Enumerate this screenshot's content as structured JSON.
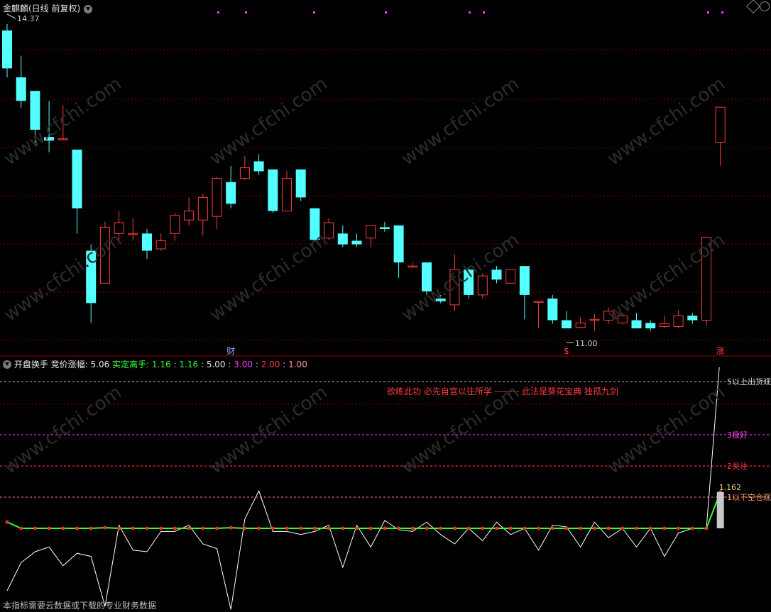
{
  "header": {
    "title": "金麒麟(日线 前复权)",
    "high_label": "14.37",
    "low_label": "11.00"
  },
  "colors": {
    "up": "#ff3d3d",
    "down": "#54ffff",
    "grid": "#7a0000",
    "green_line": "#33ff33",
    "magenta": "#ff44ff",
    "label_red": "#ff3a3a"
  },
  "price_markers": [
    {
      "label": "财",
      "color": "#7fb4ff"
    },
    {
      "label": "$",
      "color": "#ff3a3a"
    },
    {
      "label": "涨",
      "color": "#ff3a3a"
    }
  ],
  "indicator_header": {
    "name": "开盘换手",
    "jjzf_label": "竞价涨幅",
    "jjzf_value": "5.06",
    "sdlh_label": "实定离手",
    "v1": "1.16",
    "v2": "1.16",
    "v3": "5.00",
    "v4": "3.00",
    "v5": "2.00",
    "v6": "1.00"
  },
  "level_labels": {
    "l5": "5以上出货观",
    "l3": "3极好",
    "l2": "2关注",
    "l1": "1以下空仓观",
    "last_value": "1.162"
  },
  "motto": "欲练此功 必先自宫以往所学 -------- 此法是葵花宝典 独孤九剑",
  "footer": "本指标需要云数据或下载的专业财务数据",
  "watermark": "www.cfchi.com",
  "candles": [
    {
      "o": 14.3,
      "c": 13.88,
      "h": 14.37,
      "l": 13.78
    },
    {
      "o": 13.78,
      "c": 13.52,
      "h": 14.02,
      "l": 13.44
    },
    {
      "o": 13.63,
      "c": 13.2,
      "h": 13.63,
      "l": 13.02
    },
    {
      "o": 13.12,
      "c": 13.08,
      "h": 13.52,
      "l": 12.95
    },
    {
      "o": 13.1,
      "c": 13.1,
      "h": 13.47,
      "l": 13.08
    },
    {
      "o": 12.98,
      "c": 12.33,
      "h": 12.98,
      "l": 12.05
    },
    {
      "o": 11.86,
      "c": 11.28,
      "h": 11.93,
      "l": 11.06
    },
    {
      "o": 11.5,
      "c": 12.12,
      "h": 12.18,
      "l": 11.5
    },
    {
      "o": 12.05,
      "c": 12.17,
      "h": 12.3,
      "l": 11.95
    },
    {
      "o": 12.05,
      "c": 12.05,
      "h": 12.22,
      "l": 11.97
    },
    {
      "o": 12.05,
      "c": 11.86,
      "h": 12.1,
      "l": 11.77
    },
    {
      "o": 11.88,
      "c": 11.97,
      "h": 12.05,
      "l": 11.86
    },
    {
      "o": 12.05,
      "c": 12.25,
      "h": 12.28,
      "l": 11.97
    },
    {
      "o": 12.2,
      "c": 12.3,
      "h": 12.45,
      "l": 12.14
    },
    {
      "o": 12.2,
      "c": 12.45,
      "h": 12.49,
      "l": 12.03
    },
    {
      "o": 12.24,
      "c": 12.66,
      "h": 12.68,
      "l": 12.1
    },
    {
      "o": 12.62,
      "c": 12.38,
      "h": 12.8,
      "l": 12.33
    },
    {
      "o": 12.66,
      "c": 12.78,
      "h": 12.91,
      "l": 12.64
    },
    {
      "o": 12.85,
      "c": 12.74,
      "h": 12.93,
      "l": 12.7
    },
    {
      "o": 12.76,
      "c": 12.3,
      "h": 12.76,
      "l": 12.28
    },
    {
      "o": 12.3,
      "c": 12.66,
      "h": 12.74,
      "l": 12.3
    },
    {
      "o": 12.76,
      "c": 12.45,
      "h": 12.76,
      "l": 12.41
    },
    {
      "o": 12.33,
      "c": 11.98,
      "h": 12.33,
      "l": 11.97
    },
    {
      "o": 12.0,
      "c": 12.17,
      "h": 12.22,
      "l": 11.98
    },
    {
      "o": 12.05,
      "c": 11.93,
      "h": 12.14,
      "l": 11.9
    },
    {
      "o": 11.97,
      "c": 11.93,
      "h": 12.05,
      "l": 11.9
    },
    {
      "o": 12.0,
      "c": 12.14,
      "h": 12.14,
      "l": 11.9
    },
    {
      "o": 12.12,
      "c": 12.1,
      "h": 12.18,
      "l": 12.07
    },
    {
      "o": 12.14,
      "c": 11.73,
      "h": 12.14,
      "l": 11.56
    },
    {
      "o": 11.69,
      "c": 11.69,
      "h": 11.73,
      "l": 11.69
    },
    {
      "o": 11.73,
      "c": 11.41,
      "h": 11.73,
      "l": 11.37
    },
    {
      "o": 11.33,
      "c": 11.3,
      "h": 11.37,
      "l": 11.28
    },
    {
      "o": 11.26,
      "c": 11.65,
      "h": 11.82,
      "l": 11.19
    },
    {
      "o": 11.65,
      "c": 11.37,
      "h": 11.69,
      "l": 11.33
    },
    {
      "o": 11.37,
      "c": 11.58,
      "h": 11.61,
      "l": 11.33
    },
    {
      "o": 11.65,
      "c": 11.54,
      "h": 11.69,
      "l": 11.5
    },
    {
      "o": 11.5,
      "c": 11.65,
      "h": 11.65,
      "l": 11.5
    },
    {
      "o": 11.69,
      "c": 11.37,
      "h": 11.69,
      "l": 11.1
    },
    {
      "o": 11.3,
      "c": 11.3,
      "h": 11.3,
      "l": 11.0
    },
    {
      "o": 11.33,
      "c": 11.09,
      "h": 11.37,
      "l": 11.05
    },
    {
      "o": 11.09,
      "c": 11.0,
      "h": 11.19,
      "l": 11.0
    },
    {
      "o": 11.01,
      "c": 11.06,
      "h": 11.12,
      "l": 11.0
    },
    {
      "o": 11.1,
      "c": 11.1,
      "h": 11.16,
      "l": 10.97
    },
    {
      "o": 11.09,
      "c": 11.19,
      "h": 11.23,
      "l": 11.05
    },
    {
      "o": 11.06,
      "c": 11.14,
      "h": 11.17,
      "l": 11.05
    },
    {
      "o": 11.09,
      "c": 11.0,
      "h": 11.17,
      "l": 11.0
    },
    {
      "o": 11.06,
      "c": 11.0,
      "h": 11.09,
      "l": 10.97
    },
    {
      "o": 11.02,
      "c": 11.05,
      "h": 11.14,
      "l": 11.0
    },
    {
      "o": 11.02,
      "c": 11.14,
      "h": 11.2,
      "l": 11.0
    },
    {
      "o": 11.14,
      "c": 11.09,
      "h": 11.17,
      "l": 11.05
    },
    {
      "o": 11.09,
      "c": 12.01,
      "h": 12.01,
      "l": 11.03
    },
    {
      "o": 13.06,
      "c": 13.45,
      "h": 13.45,
      "l": 12.8
    }
  ],
  "indicator": {
    "white": [
      -2.0,
      -1.1,
      -0.75,
      -0.6,
      -1.2,
      -0.8,
      -0.9,
      -2.5,
      0.1,
      -0.7,
      -0.75,
      -0.1,
      -0.1,
      0.1,
      -0.5,
      -0.65,
      -2.6,
      0.3,
      1.2,
      -0.1,
      -0.1,
      -0.2,
      -0.1,
      0.1,
      -1.25,
      0.1,
      -0.6,
      0.25,
      -0.05,
      -0.1,
      0.2,
      -0.2,
      -0.5,
      0.0,
      -0.4,
      0.2,
      -0.2,
      0.0,
      -0.7,
      0.1,
      0.05,
      -0.6,
      0.2,
      -0.3,
      0.0,
      -0.6,
      0.0,
      -0.9,
      -0.15,
      0.0,
      0.0,
      5.6
    ],
    "green": [
      0.2,
      0.0,
      0.0,
      0.0,
      0.0,
      0.0,
      0.0,
      0.02,
      0.0,
      0.0,
      0.0,
      0.0,
      0.0,
      0.0,
      0.0,
      0.0,
      0.02,
      0.0,
      0.0,
      0.0,
      0.0,
      0.0,
      0.0,
      0.0,
      0.0,
      0.0,
      0.0,
      0.0,
      0.0,
      0.0,
      0.0,
      0.0,
      0.0,
      0.0,
      0.0,
      0.0,
      0.0,
      0.0,
      0.0,
      0.0,
      0.0,
      0.0,
      0.0,
      0.0,
      0.0,
      0.0,
      0.0,
      0.0,
      0.0,
      0.0,
      0.0,
      1.162
    ]
  }
}
